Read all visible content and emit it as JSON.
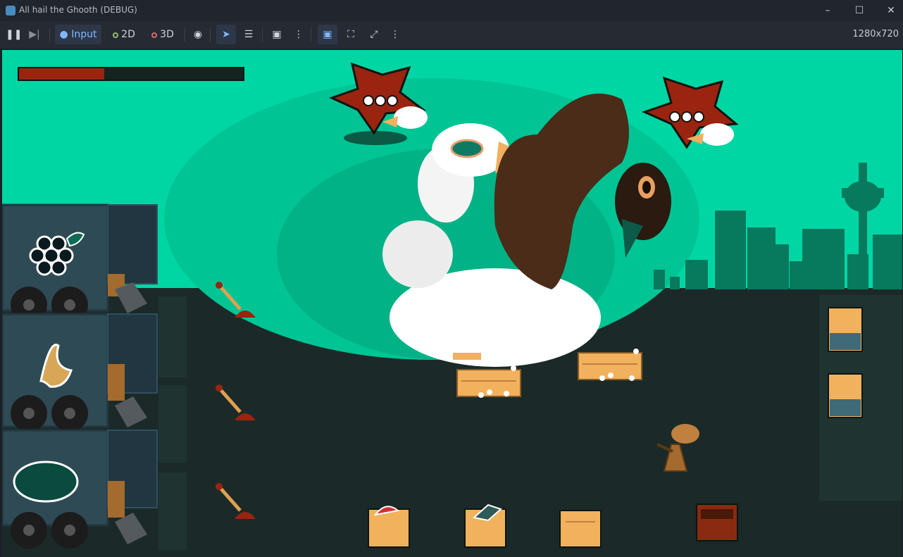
{
  "window": {
    "title": "All hail the Ghooth (DEBUG)"
  },
  "toolbar": {
    "input_label": "Input",
    "view_2d_label": "2D",
    "view_3d_label": "3D",
    "resolution": "1280x720"
  },
  "game": {
    "health_fraction": 0.38,
    "palette": {
      "sky": "#00d6a4",
      "ground": "#1b2a28",
      "health": "#9a2410",
      "crate": "#f2b15c"
    }
  }
}
